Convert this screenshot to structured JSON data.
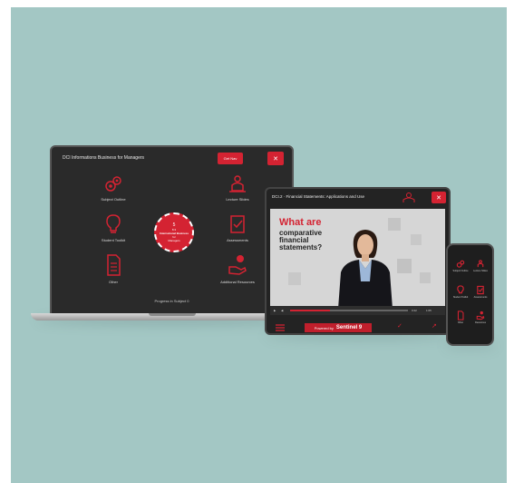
{
  "colors": {
    "background": "#a3c7c4",
    "accent": "#d42332",
    "screen": "#2a2a2a"
  },
  "laptop": {
    "title": "DCI Informations Business for Managers",
    "button_label": "Get Nav",
    "menu_icon": "close-icon",
    "items": [
      {
        "label": "Subject Outline",
        "icon": "gears-icon"
      },
      {
        "label": "Lecture Slides",
        "icon": "presenter-icon"
      },
      {
        "label": "Student Toolkit",
        "icon": "lightbulb-icon"
      },
      {
        "label": "Assessments",
        "icon": "checklist-icon"
      },
      {
        "label": "Other",
        "icon": "document-icon"
      },
      {
        "label": "Additional Resources",
        "icon": "hand-icon"
      }
    ],
    "center": {
      "number": "5",
      "line1": "8.3",
      "line2": "International Business",
      "line3": "for",
      "line4": "Managers"
    },
    "progress_text": "Progress in Subject 0"
  },
  "tablet": {
    "title": "DCI.2 · Financial Statements: Applications and Use",
    "video_headline": "What are",
    "video_subtitle": "comparative financial statements?",
    "time_left": "0:22",
    "time_right": "1:05",
    "powered_by": "Powered by",
    "brand": "Sentinel 9"
  },
  "phone": {
    "items": [
      {
        "label": "Subject Outline",
        "icon": "gears-icon"
      },
      {
        "label": "Lecture Slides",
        "icon": "presenter-icon"
      },
      {
        "label": "Student Toolkit",
        "icon": "lightbulb-icon"
      },
      {
        "label": "Assessments",
        "icon": "checklist-icon"
      },
      {
        "label": "Other",
        "icon": "document-icon"
      },
      {
        "label": "Resources",
        "icon": "hand-icon"
      }
    ]
  }
}
